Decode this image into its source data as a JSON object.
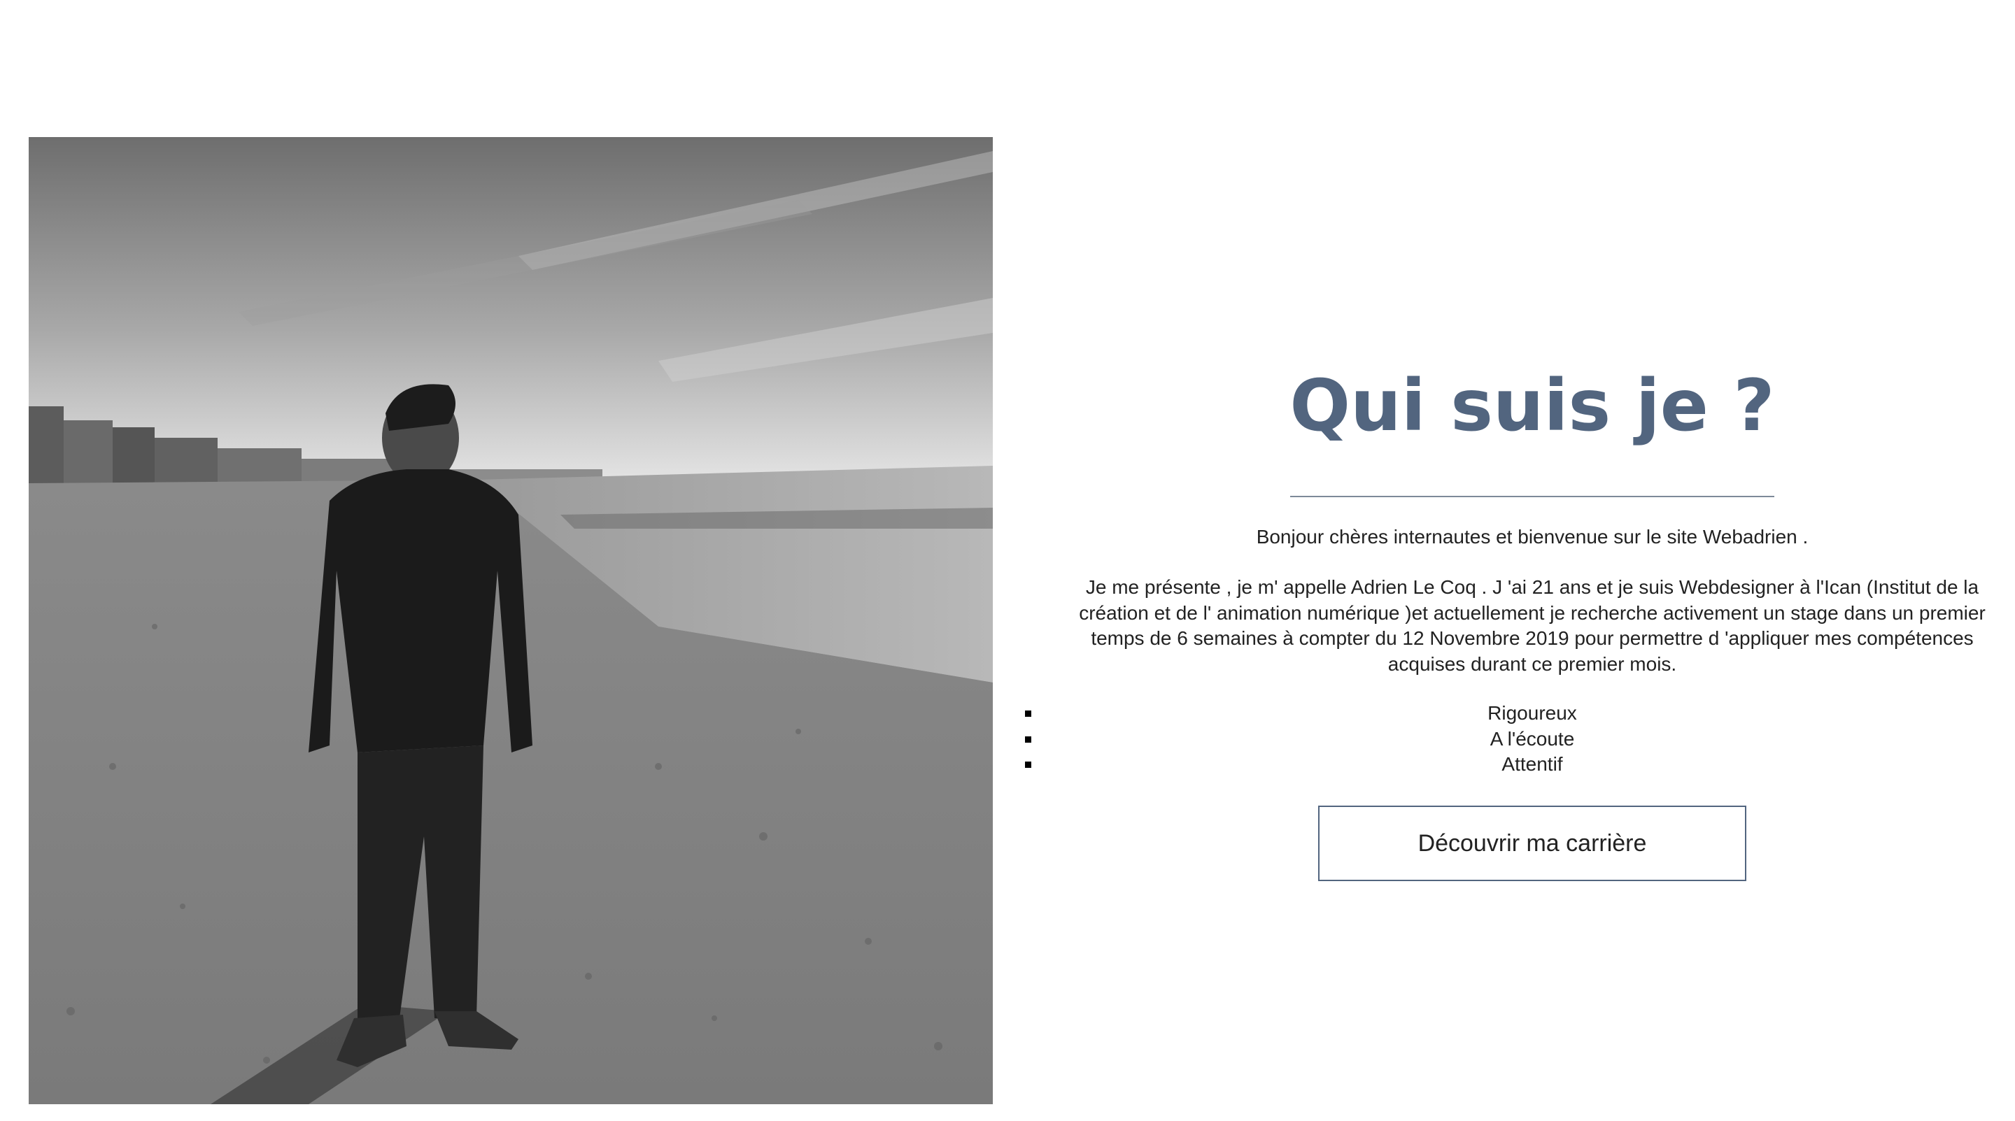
{
  "photo": {
    "icon": "portrait-photo-beach"
  },
  "about": {
    "title": "Qui suis je ?",
    "intro": "Bonjour chères internautes et bienvenue sur le site Webadrien .",
    "presentation": "Je me présente , je m' appelle Adrien Le Coq . J 'ai 21 ans et je suis Webdesigner à l'Ican (Institut de la création et de l' animation numérique )et actuellement je recherche activement un stage dans un premier temps de 6 semaines à compter du 12 Novembre 2019 pour permettre d 'appliquer mes compétences acquises durant ce premier mois.",
    "qualities": [
      "Rigoureux",
      "A l'écoute",
      "Attentif"
    ],
    "cta_label": "Découvrir ma carrière"
  },
  "colors": {
    "accent": "#52657f",
    "text": "#222222",
    "background": "#ffffff"
  }
}
